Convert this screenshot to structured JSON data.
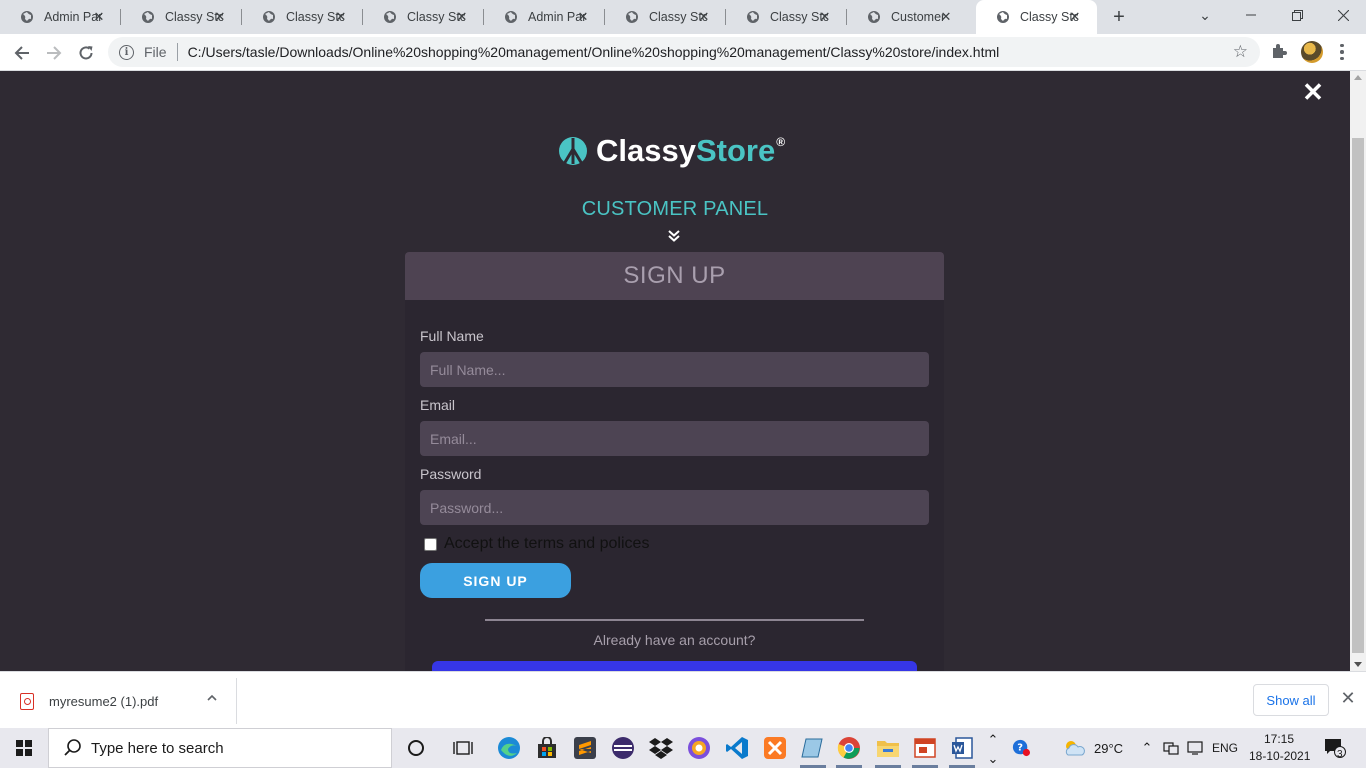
{
  "browser": {
    "tabs": [
      {
        "title": "Admin Panel",
        "active": false
      },
      {
        "title": "Classy Store",
        "active": false
      },
      {
        "title": "Classy Store",
        "active": false
      },
      {
        "title": "Classy Store",
        "active": false
      },
      {
        "title": "Admin Panel",
        "active": false
      },
      {
        "title": "Classy Store",
        "active": false
      },
      {
        "title": "Classy Store",
        "active": false
      },
      {
        "title": "Customer Panel",
        "active": false
      },
      {
        "title": "Classy Store",
        "active": true
      }
    ],
    "address": {
      "protocol_label": "File",
      "url": "C:/Users/tasle/Downloads/Online%20shopping%20management/Online%20shopping%20management/Classy%20store/index.html"
    }
  },
  "page": {
    "brand": {
      "part1": "Classy",
      "part2": "Store",
      "reg": "®"
    },
    "panel_title": "CUSTOMER PANEL",
    "form": {
      "heading": "SIGN UP",
      "fields": [
        {
          "label": "Full Name",
          "placeholder": "Full Name..."
        },
        {
          "label": "Email",
          "placeholder": "Email..."
        },
        {
          "label": "Password",
          "placeholder": "Password..."
        }
      ],
      "terms_text": "Accept the terms and polices",
      "submit_label": "SIGN UP",
      "already_text": "Already have an account?"
    },
    "colors": {
      "accent": "#4ac4c4",
      "button": "#3ba0e0",
      "login_button": "#3636e6",
      "background": "#2f2a33"
    }
  },
  "downloads": {
    "file_name": "myresume2 (1).pdf",
    "show_all_label": "Show all"
  },
  "taskbar": {
    "search_placeholder": "Type here to search",
    "weather": "29°C",
    "language": "ENG",
    "time": "17:15",
    "date": "18-10-2021",
    "notification_count": "3"
  }
}
